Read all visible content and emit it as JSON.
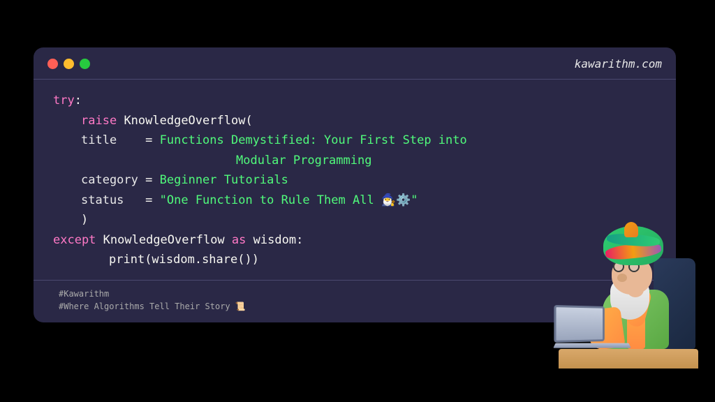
{
  "window": {
    "site": "kawarithm.com"
  },
  "code": {
    "try_kw": "try",
    "colon": ":",
    "raise_kw": "raise",
    "class_name": "KnowledgeOverflow",
    "open_paren": "(",
    "param_title": "title",
    "eq": "=",
    "title_val_l1": "Functions Demystified: Your First Step into",
    "title_val_l2": "Modular Programming",
    "param_category": "category",
    "category_val": "Beginner Tutorials",
    "param_status": "status",
    "status_val": "\"One Function to Rule Them All 🧙‍♂️⚙️\"",
    "close_paren": ")",
    "except_kw": "except",
    "as_kw": "as",
    "wisdom_var": "wisdom",
    "print_fn": "print",
    "share_call": "(wisdom.share())"
  },
  "footer": {
    "tag1": "#Kawarithm",
    "tag2": "#Where Algorithms Tell Their Story 📜"
  },
  "colors": {
    "bg": "#000000",
    "window_bg": "#2a2846",
    "keyword_pink": "#ff79c6",
    "string_green": "#50fa7b",
    "text": "#f8f8f2"
  }
}
